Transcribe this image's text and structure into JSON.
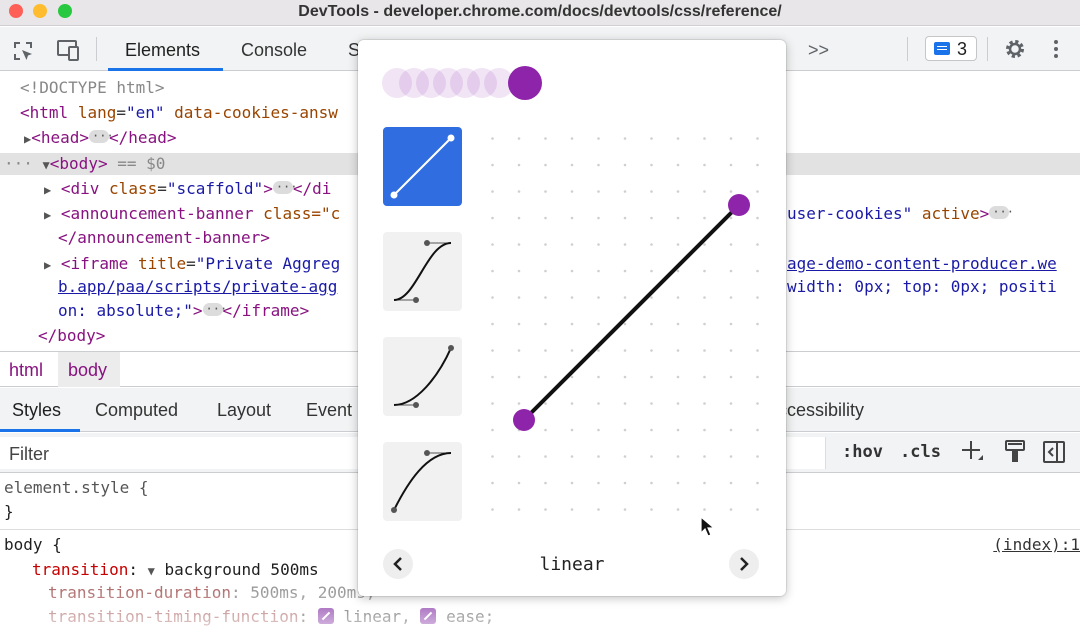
{
  "window": {
    "title": "DevTools - developer.chrome.com/docs/devtools/css/reference/"
  },
  "toolbar": {
    "tabs": [
      "Elements",
      "Console",
      "S"
    ],
    "more_label": ">>",
    "issues_count": "3"
  },
  "dom": {
    "doctype": "<!DOCTYPE html>",
    "html_open": "<html",
    "html_attr": "lang",
    "html_attr_val": "\"en\"",
    "html_attr2": "data-cookies-answ",
    "head_open": "<head>",
    "head_close": "</head>",
    "body_open": "<body>",
    "body_eq": "== $0",
    "div_open": "<div",
    "div_attr": "class",
    "div_val": "\"scaffold\"",
    "div_close_frag": "</di",
    "banner_open": "<announcement-banner",
    "banner_attr": "class=\"c",
    "banner_rest": "user-cookies\"",
    "banner_active": "active",
    "banner_close": "</announcement-banner>",
    "iframe_open": "<iframe",
    "iframe_attr": "title",
    "iframe_val": "\"Private Aggreg",
    "iframe_link_a": "age-demo-content-producer.we",
    "iframe_link_b": "b.app/paa/scripts/private-agg",
    "iframe_style": "width: 0px; top: 0px; positi",
    "iframe_style2": "on: absolute;\"",
    "iframe_close": "</iframe>",
    "body_close": "</body>"
  },
  "breadcrumb": [
    "html",
    "body"
  ],
  "styles_tabs": [
    "Styles",
    "Computed",
    "Layout",
    "Event",
    "ccessibility"
  ],
  "filter": {
    "placeholder": "Filter",
    "hov": ":hov",
    "cls": ".cls"
  },
  "styles": {
    "element_selector": "element.style {",
    "element_close": "}",
    "body_selector": "body {",
    "source": "(index):1",
    "transition_prop": "transition",
    "transition_val": "background 500ms",
    "duration_prop": "transition-duration",
    "duration_val": "500ms, 200ms;",
    "timing_prop": "transition-timing-function",
    "timing_val1": "linear,",
    "timing_val2": "ease;"
  },
  "easing_editor": {
    "current": "linear",
    "prev_label": "<",
    "next_label": ">",
    "accent": "#8e24aa",
    "selected_preset_color": "#2f6de1"
  }
}
